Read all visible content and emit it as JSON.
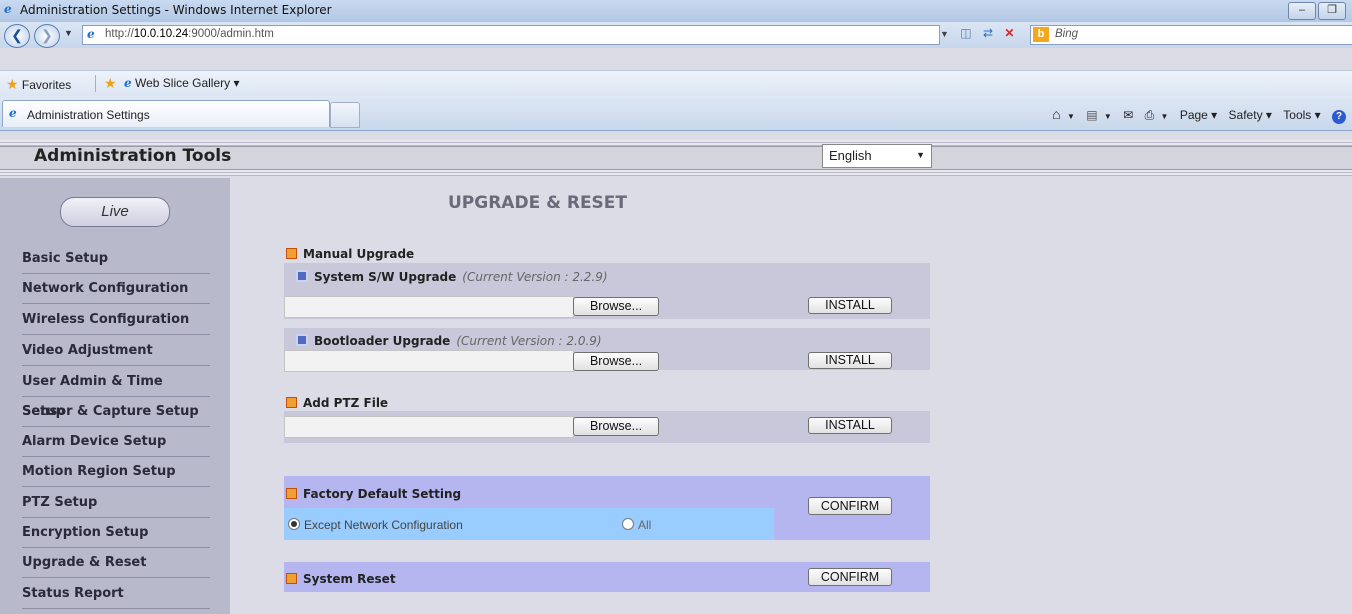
{
  "window": {
    "title": "Administration Settings - Windows Internet Explorer",
    "url_prefix": "http://",
    "url_host": "10.0.10.24",
    "url_suffix": ":9000/admin.htm",
    "search_placeholder": "Bing"
  },
  "favorites": {
    "label": "Favorites",
    "web_slice": "Web Slice Gallery ▾"
  },
  "tab": {
    "label": "Administration Settings"
  },
  "commandbar": {
    "page": "Page ▾",
    "safety": "Safety ▾",
    "tools": "Tools ▾"
  },
  "header": {
    "title": "Administration Tools",
    "language": "English"
  },
  "sidebar": {
    "live": "Live",
    "items": [
      "Basic Setup",
      "Network Configuration",
      "Wireless Configuration",
      "Video Adjustment",
      "User Admin & Time Setup",
      "Sensor & Capture Setup",
      "Alarm Device Setup",
      "Motion Region Setup",
      "PTZ Setup",
      "Encryption Setup",
      "Upgrade & Reset",
      "Status Report"
    ]
  },
  "main": {
    "title": "UPGRADE & RESET",
    "manual_upgrade": "Manual Upgrade",
    "sw_upgrade": "System S/W Upgrade",
    "sw_version": "(Current Version : 2.2.9)",
    "boot_upgrade": "Bootloader Upgrade",
    "boot_version": "(Current Version : 2.0.9)",
    "ptz_file": "Add PTZ File",
    "browse": "Browse...",
    "install": "INSTALL",
    "factory_default": "Factory Default Setting",
    "except_network": "Except Network Configuration",
    "all": "All",
    "confirm": "CONFIRM",
    "system_reset": "System Reset"
  }
}
